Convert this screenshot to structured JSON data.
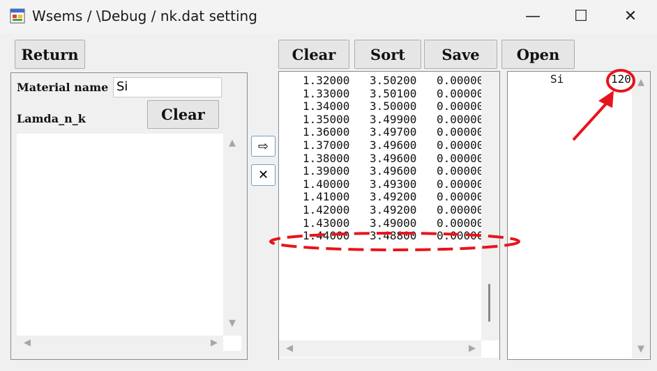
{
  "window": {
    "title": "Wsems / \\Debug / nk.dat setting",
    "minimize_glyph": "—",
    "maximize_glyph": "☐",
    "close_glyph": "✕"
  },
  "left": {
    "return_label": "Return",
    "material_name_label": "Material name",
    "material_name_value": "Si",
    "lamda_label": "Lamda_n_k",
    "clear_label": "Clear"
  },
  "middle": {
    "clear_label": "Clear",
    "sort_label": "Sort",
    "save_label": "Save",
    "rows": [
      [
        "1.32000",
        "3.50200",
        "0.00000"
      ],
      [
        "1.33000",
        "3.50100",
        "0.00000"
      ],
      [
        "1.34000",
        "3.50000",
        "0.00000"
      ],
      [
        "1.35000",
        "3.49900",
        "0.00000"
      ],
      [
        "1.36000",
        "3.49700",
        "0.00000"
      ],
      [
        "1.37000",
        "3.49600",
        "0.00000"
      ],
      [
        "1.38000",
        "3.49600",
        "0.00000"
      ],
      [
        "1.39000",
        "3.49600",
        "0.00000"
      ],
      [
        "1.40000",
        "3.49300",
        "0.00000"
      ],
      [
        "1.41000",
        "3.49200",
        "0.00000"
      ],
      [
        "1.42000",
        "3.49200",
        "0.00000"
      ],
      [
        "1.43000",
        "3.49000",
        "0.00000"
      ],
      [
        "1.44000",
        "3.48800",
        "0.00000"
      ]
    ]
  },
  "right": {
    "open_label": "Open",
    "material": "Si",
    "count": "120"
  },
  "transfer": {
    "add_glyph": "⇨",
    "remove_glyph": "✕"
  },
  "colors": {
    "annotation": "#e8141b",
    "button_border_blue": "#7a9cc8"
  },
  "icons": [
    "app-icon",
    "arrow-right-icon",
    "x-icon",
    "scroll-up-icon",
    "scroll-down-icon",
    "scroll-left-icon",
    "scroll-right-icon"
  ]
}
